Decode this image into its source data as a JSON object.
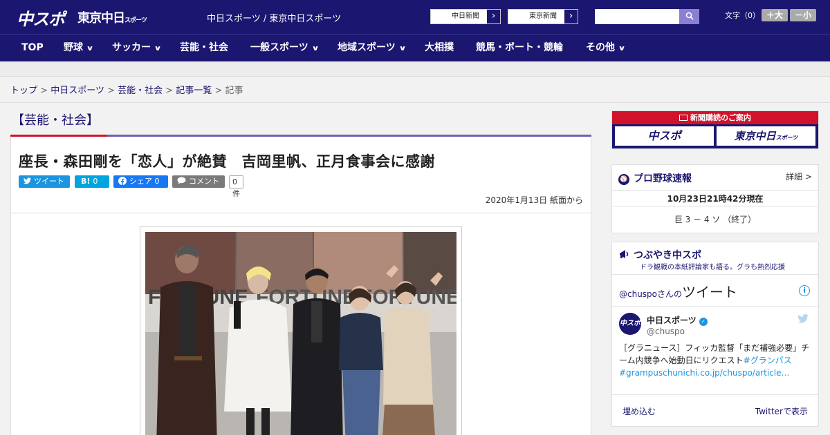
{
  "header": {
    "logo_chuspo": "中スポ",
    "logo_tokyo": "東京中日",
    "logo_tokyo_small": "スポーツ",
    "site_names": "中日スポーツ / 東京中日スポーツ",
    "paper_links": [
      "中日新聞",
      "東京新聞"
    ],
    "fontsize_label": "文字（0）",
    "fontsize_up": "＋大",
    "fontsize_down": "－小",
    "search_placeholder": ""
  },
  "nav": {
    "items": [
      "TOP",
      "野球",
      "サッカー",
      "芸能・社会",
      "一般スポーツ",
      "地域スポーツ",
      "大相撲",
      "競馬・ボート・競輪",
      "その他"
    ]
  },
  "breadcrumb": {
    "items": [
      "トップ",
      "中日スポーツ",
      "芸能・社会",
      "記事一覧"
    ],
    "current": "記事",
    "separator": ">"
  },
  "category": "【芸能・社会】",
  "article": {
    "headline": "座長・森田剛を「恋人」が絶賛　吉岡里帆、正月食事会に感謝",
    "share": {
      "tweet": "ツイート",
      "hatena": "B!",
      "hatena_count": "0",
      "facebook": "シェア",
      "facebook_count": "0",
      "comment": "コメント",
      "comment_count": "0件"
    },
    "date": "2020年1月13日 紙面から",
    "photo_poster_text": "FORTUNE"
  },
  "sidebar": {
    "promo_title": "新聞購読のご案内",
    "promo_logo_1": "中スポ",
    "promo_logo_2": "東京中日",
    "promo_logo_2_small": "スポーツ",
    "baseball": {
      "title": "プロ野球速報",
      "detail": "詳細 >",
      "timestamp": "10月23日21時42分現在",
      "score": "巨 3 － 4 ソ （終了）"
    },
    "tweets": {
      "title": "つぶやき中スポ",
      "subtitle": "ドラ観戦の本紙評論家も語る。グラも熱烈応援",
      "user_handle_text": "@chuspoさんの",
      "user_tweet_label": "ツイート",
      "account_name": "中日スポーツ",
      "account_handle": "@chuspo",
      "avatar_text": "中スポ",
      "tweet_text": "［グラニュース］フィッカ監督「まだ補強必要」チーム内競争へ始動日にリクエスト",
      "tweet_hashtag": "#グランパス",
      "tweet_link": "#grampuschunichi.co.jp/chuspo/article…",
      "embed": "埋め込む",
      "view_on_twitter": "Twitterで表示"
    }
  },
  "colors": {
    "brand_navy": "#1b1670",
    "accent_red": "#d0132b",
    "twitter_blue": "#1b95e0",
    "facebook_blue": "#1877f2",
    "hatena_blue": "#00a4de"
  }
}
